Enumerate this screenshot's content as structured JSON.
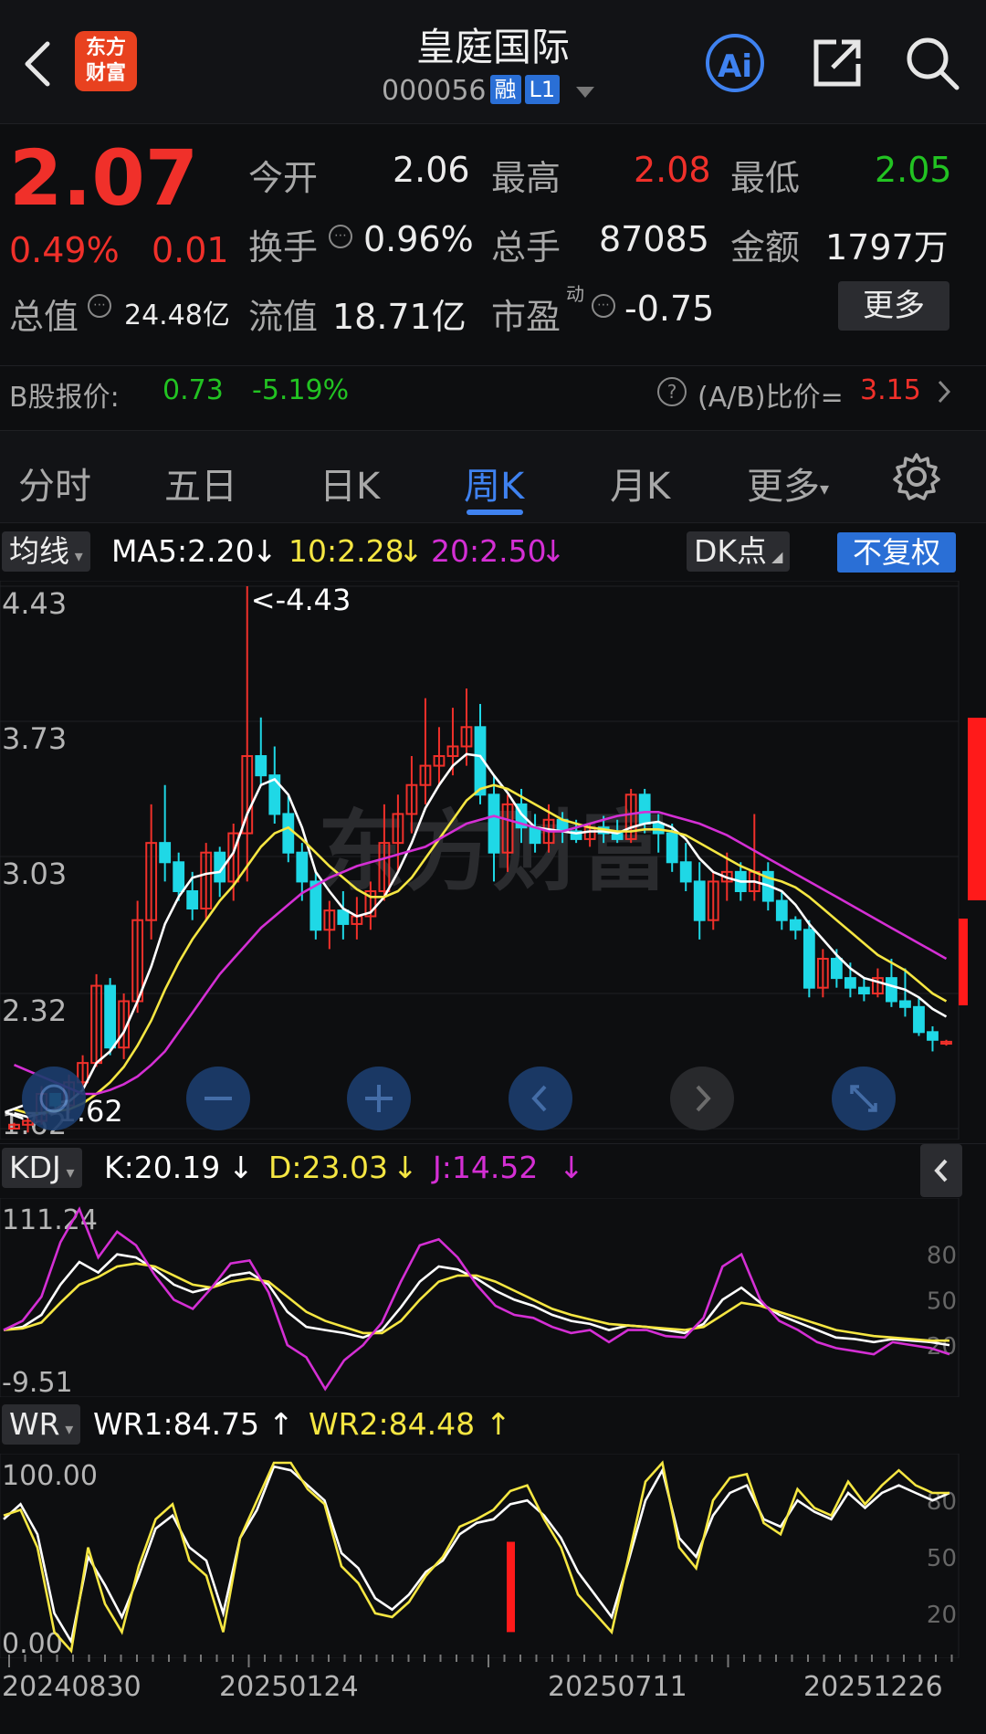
{
  "header": {
    "title": "皇庭国际",
    "code": "000056",
    "tag_rong": "融",
    "tag_level": "L1",
    "logo_line1": "东方",
    "logo_line2": "财富",
    "ai_label": "Ai"
  },
  "quote": {
    "price": "2.07",
    "change_pct": "0.49%",
    "change": "0.01",
    "open_label": "今开",
    "open": "2.06",
    "high_label": "最高",
    "high": "2.08",
    "low_label": "最低",
    "low": "2.05",
    "turnover_label": "换手",
    "turnover": "0.96%",
    "volume_label": "总手",
    "volume": "87085",
    "amount_label": "金额",
    "amount": "1797万",
    "mktcap_label": "总值",
    "mktcap": "24.48亿",
    "float_label": "流值",
    "float": "18.71亿",
    "pe_label": "市盈",
    "pe_sup": "动",
    "pe": "-0.75",
    "more_label": "更多"
  },
  "b_share": {
    "label": "B股报价:",
    "price": "0.73",
    "change_pct": "-5.19%",
    "ratio_label": "(A/B)比价=",
    "ratio": "3.15"
  },
  "tabs": [
    {
      "label": "分时"
    },
    {
      "label": "五日"
    },
    {
      "label": "日K"
    },
    {
      "label": "周K"
    },
    {
      "label": "月K"
    },
    {
      "label": "更多"
    }
  ],
  "ma_bar": {
    "dropdown": "均线",
    "ma5": "MA5:2.20",
    "ma10": "10:2.28",
    "ma20": "20:2.50",
    "dk": "DK点",
    "adjust": "不复权"
  },
  "main_chart": {
    "y_labels": [
      "4.43",
      "3.73",
      "3.03",
      "2.32",
      "1.62"
    ],
    "max_marker": "<-4.43",
    "min_marker": "<---1.62",
    "watermark": "东方财富"
  },
  "kdj_bar": {
    "dropdown": "KDJ",
    "k": "K:20.19",
    "d": "D:23.03",
    "j": "J:14.52"
  },
  "kdj_chart": {
    "y_top": "111.24",
    "y_bottom": "-9.51",
    "right_labels": [
      "80",
      "50",
      "20"
    ]
  },
  "wr_bar": {
    "dropdown": "WR",
    "wr1": "WR1:84.75",
    "wr2": "WR2:84.48"
  },
  "wr_chart": {
    "y_top": "100.00",
    "y_bottom": "0.00",
    "right_labels": [
      "80",
      "50",
      "20"
    ]
  },
  "x_axis": [
    "20240830",
    "20250124",
    "20250711",
    "20251226"
  ],
  "colors": {
    "up": "#f0302a",
    "down": "#1fd8e6",
    "ma5": "#ffffff",
    "ma10": "#f5e642",
    "ma20": "#d42fd4",
    "accent": "#3f82f0"
  },
  "chart_data": [
    {
      "type": "candlestick",
      "title": "",
      "ylim": [
        1.62,
        4.43
      ],
      "y_ticks": [
        4.43,
        3.73,
        3.03,
        2.32,
        1.62
      ],
      "period": "weekly",
      "x_start": "20240830",
      "x_end": "20251226",
      "x_ticks": [
        "20240830",
        "20250124",
        "20250711",
        "20251226"
      ],
      "candles": [
        [
          1.62,
          1.65,
          1.62,
          1.64
        ],
        [
          1.64,
          1.68,
          1.6,
          1.66
        ],
        [
          1.66,
          1.84,
          1.64,
          1.8
        ],
        [
          1.8,
          1.78,
          1.72,
          1.74
        ],
        [
          1.74,
          1.9,
          1.7,
          1.86
        ],
        [
          1.86,
          2.0,
          1.82,
          1.96
        ],
        [
          1.96,
          2.42,
          1.94,
          2.36
        ],
        [
          2.36,
          2.4,
          2.0,
          2.04
        ],
        [
          2.04,
          2.32,
          1.98,
          2.28
        ],
        [
          2.28,
          2.8,
          2.22,
          2.7
        ],
        [
          2.7,
          3.3,
          2.6,
          3.1
        ],
        [
          3.1,
          3.4,
          2.9,
          3.0
        ],
        [
          3.0,
          3.05,
          2.8,
          2.85
        ],
        [
          2.85,
          2.95,
          2.7,
          2.76
        ],
        [
          2.76,
          3.1,
          2.7,
          3.05
        ],
        [
          3.05,
          3.08,
          2.82,
          2.9
        ],
        [
          2.9,
          3.2,
          2.8,
          3.15
        ],
        [
          3.15,
          4.43,
          2.9,
          3.55
        ],
        [
          3.55,
          3.75,
          3.4,
          3.45
        ],
        [
          3.45,
          3.6,
          3.2,
          3.25
        ],
        [
          3.25,
          3.35,
          3.0,
          3.05
        ],
        [
          3.05,
          3.1,
          2.8,
          2.9
        ],
        [
          2.9,
          2.95,
          2.6,
          2.65
        ],
        [
          2.65,
          2.8,
          2.55,
          2.75
        ],
        [
          2.75,
          2.85,
          2.6,
          2.68
        ],
        [
          2.68,
          2.82,
          2.6,
          2.72
        ],
        [
          2.72,
          2.9,
          2.65,
          2.85
        ],
        [
          2.85,
          3.3,
          2.8,
          3.1
        ],
        [
          3.1,
          3.35,
          2.95,
          3.25
        ],
        [
          3.25,
          3.55,
          3.15,
          3.4
        ],
        [
          3.4,
          3.85,
          3.3,
          3.5
        ],
        [
          3.5,
          3.7,
          3.4,
          3.55
        ],
        [
          3.55,
          3.8,
          3.45,
          3.6
        ],
        [
          3.6,
          3.9,
          3.5,
          3.7
        ],
        [
          3.7,
          3.82,
          3.3,
          3.35
        ],
        [
          3.35,
          3.45,
          2.9,
          3.05
        ],
        [
          3.05,
          3.35,
          2.95,
          3.3
        ],
        [
          3.3,
          3.38,
          3.1,
          3.18
        ],
        [
          3.18,
          3.25,
          3.05,
          3.1
        ],
        [
          3.1,
          3.3,
          3.05,
          3.22
        ],
        [
          3.22,
          3.26,
          3.1,
          3.16
        ],
        [
          3.16,
          3.22,
          3.1,
          3.12
        ],
        [
          3.12,
          3.2,
          3.08,
          3.18
        ],
        [
          3.18,
          3.24,
          3.1,
          3.15
        ],
        [
          3.15,
          3.22,
          3.1,
          3.12
        ],
        [
          3.12,
          3.38,
          3.1,
          3.35
        ],
        [
          3.35,
          3.38,
          3.15,
          3.2
        ],
        [
          3.2,
          3.25,
          3.05,
          3.15
        ],
        [
          3.15,
          3.2,
          2.95,
          3.0
        ],
        [
          3.0,
          3.1,
          2.85,
          2.9
        ],
        [
          2.9,
          3.0,
          2.6,
          2.7
        ],
        [
          2.7,
          2.95,
          2.65,
          2.9
        ],
        [
          2.9,
          3.05,
          2.8,
          2.95
        ],
        [
          2.95,
          3.0,
          2.8,
          2.85
        ],
        [
          2.85,
          3.25,
          2.8,
          2.95
        ],
        [
          2.95,
          3.0,
          2.75,
          2.8
        ],
        [
          2.8,
          2.85,
          2.65,
          2.7
        ],
        [
          2.7,
          2.72,
          2.6,
          2.65
        ],
        [
          2.65,
          2.7,
          2.3,
          2.35
        ],
        [
          2.35,
          2.55,
          2.3,
          2.5
        ],
        [
          2.5,
          2.55,
          2.35,
          2.4
        ],
        [
          2.4,
          2.48,
          2.3,
          2.35
        ],
        [
          2.35,
          2.4,
          2.28,
          2.32
        ],
        [
          2.32,
          2.45,
          2.3,
          2.4
        ],
        [
          2.4,
          2.5,
          2.25,
          2.28
        ],
        [
          2.28,
          2.45,
          2.2,
          2.25
        ],
        [
          2.25,
          2.3,
          2.1,
          2.12
        ],
        [
          2.12,
          2.15,
          2.02,
          2.08
        ],
        [
          2.06,
          2.08,
          2.05,
          2.07
        ]
      ],
      "series": [
        {
          "name": "MA5",
          "values": [
            1.7,
            1.68,
            1.7,
            1.72,
            1.76,
            1.82,
            1.96,
            2.02,
            2.12,
            2.28,
            2.46,
            2.68,
            2.82,
            2.92,
            2.94,
            2.95,
            3.05,
            3.25,
            3.4,
            3.43,
            3.35,
            3.18,
            2.95,
            2.85,
            2.76,
            2.72,
            2.74,
            2.82,
            2.95,
            3.1,
            3.28,
            3.4,
            3.5,
            3.56,
            3.55,
            3.45,
            3.36,
            3.25,
            3.18,
            3.17,
            3.16,
            3.15,
            3.16,
            3.16,
            3.15,
            3.18,
            3.2,
            3.21,
            3.18,
            3.12,
            3.02,
            2.95,
            2.92,
            2.9,
            2.9,
            2.88,
            2.85,
            2.78,
            2.68,
            2.6,
            2.52,
            2.45,
            2.4,
            2.38,
            2.36,
            2.34,
            2.3,
            2.24,
            2.2
          ]
        },
        {
          "name": "10",
          "values": [
            1.72,
            1.7,
            1.7,
            1.71,
            1.72,
            1.75,
            1.8,
            1.86,
            1.94,
            2.05,
            2.18,
            2.34,
            2.48,
            2.6,
            2.7,
            2.8,
            2.88,
            2.98,
            3.08,
            3.15,
            3.18,
            3.12,
            3.05,
            2.98,
            2.92,
            2.86,
            2.82,
            2.82,
            2.85,
            2.92,
            3.02,
            3.12,
            3.22,
            3.32,
            3.38,
            3.4,
            3.38,
            3.34,
            3.3,
            3.26,
            3.22,
            3.2,
            3.18,
            3.17,
            3.16,
            3.16,
            3.17,
            3.17,
            3.16,
            3.14,
            3.1,
            3.06,
            3.02,
            2.98,
            2.95,
            2.92,
            2.9,
            2.87,
            2.82,
            2.76,
            2.7,
            2.64,
            2.58,
            2.52,
            2.48,
            2.44,
            2.38,
            2.32,
            2.28
          ]
        },
        {
          "name": "20",
          "values": [
            1.95,
            1.92,
            1.89,
            1.86,
            1.83,
            1.8,
            1.8,
            1.82,
            1.85,
            1.89,
            1.95,
            2.02,
            2.12,
            2.22,
            2.32,
            2.42,
            2.5,
            2.58,
            2.66,
            2.72,
            2.78,
            2.84,
            2.88,
            2.92,
            2.95,
            2.98,
            3.0,
            3.02,
            3.04,
            3.06,
            3.08,
            3.12,
            3.16,
            3.2,
            3.22,
            3.24,
            3.22,
            3.2,
            3.18,
            3.16,
            3.16,
            3.18,
            3.2,
            3.22,
            3.24,
            3.25,
            3.26,
            3.26,
            3.24,
            3.22,
            3.2,
            3.17,
            3.14,
            3.1,
            3.06,
            3.02,
            2.98,
            2.94,
            2.9,
            2.86,
            2.82,
            2.78,
            2.74,
            2.7,
            2.66,
            2.62,
            2.58,
            2.54,
            2.5
          ]
        }
      ]
    },
    {
      "type": "line",
      "title": "KDJ",
      "ylim": [
        -9.51,
        111.24
      ],
      "series": [
        {
          "name": "K",
          "values": [
            30,
            32,
            40,
            60,
            75,
            68,
            80,
            78,
            70,
            60,
            55,
            58,
            66,
            68,
            60,
            42,
            32,
            30,
            28,
            25,
            30,
            45,
            62,
            72,
            70,
            64,
            56,
            50,
            46,
            40,
            36,
            34,
            30,
            33,
            32,
            30,
            28,
            34,
            50,
            58,
            48,
            40,
            35,
            30,
            25,
            24,
            22,
            24,
            23,
            22,
            20
          ]
        },
        {
          "name": "D",
          "values": [
            30,
            31,
            35,
            48,
            60,
            65,
            72,
            74,
            72,
            66,
            60,
            58,
            62,
            64,
            62,
            52,
            42,
            36,
            32,
            28,
            28,
            36,
            50,
            62,
            66,
            66,
            62,
            56,
            50,
            44,
            40,
            37,
            34,
            33,
            32,
            31,
            30,
            32,
            40,
            48,
            46,
            42,
            38,
            34,
            30,
            28,
            26,
            25,
            24,
            23,
            23
          ]
        },
        {
          "name": "J",
          "values": [
            30,
            36,
            52,
            88,
            110,
            78,
            95,
            86,
            66,
            50,
            44,
            58,
            74,
            76,
            55,
            20,
            12,
            -9,
            10,
            20,
            35,
            62,
            86,
            90,
            78,
            60,
            46,
            40,
            38,
            32,
            28,
            30,
            22,
            30,
            30,
            26,
            25,
            38,
            72,
            80,
            50,
            36,
            30,
            22,
            18,
            16,
            14,
            22,
            20,
            18,
            14
          ]
        }
      ]
    },
    {
      "type": "line",
      "title": "WR",
      "ylim": [
        0,
        100
      ],
      "series": [
        {
          "name": "WR1",
          "values": [
            70,
            78,
            62,
            20,
            5,
            50,
            35,
            18,
            40,
            65,
            72,
            55,
            48,
            20,
            60,
            75,
            98,
            96,
            88,
            80,
            52,
            44,
            28,
            22,
            30,
            42,
            48,
            62,
            68,
            70,
            78,
            80,
            72,
            60,
            42,
            30,
            18,
            48,
            80,
            96,
            60,
            50,
            72,
            84,
            88,
            70,
            66,
            80,
            74,
            70,
            84,
            76,
            84,
            88,
            84,
            80,
            84
          ]
        },
        {
          "name": "WR2",
          "values": [
            72,
            75,
            55,
            10,
            0,
            55,
            25,
            10,
            45,
            70,
            78,
            48,
            40,
            10,
            60,
            80,
            100,
            100,
            86,
            78,
            45,
            36,
            20,
            18,
            26,
            40,
            50,
            66,
            70,
            75,
            85,
            88,
            70,
            55,
            30,
            20,
            10,
            50,
            90,
            100,
            55,
            44,
            80,
            92,
            94,
            68,
            62,
            86,
            76,
            72,
            90,
            78,
            88,
            96,
            88,
            84,
            84
          ]
        }
      ]
    }
  ]
}
